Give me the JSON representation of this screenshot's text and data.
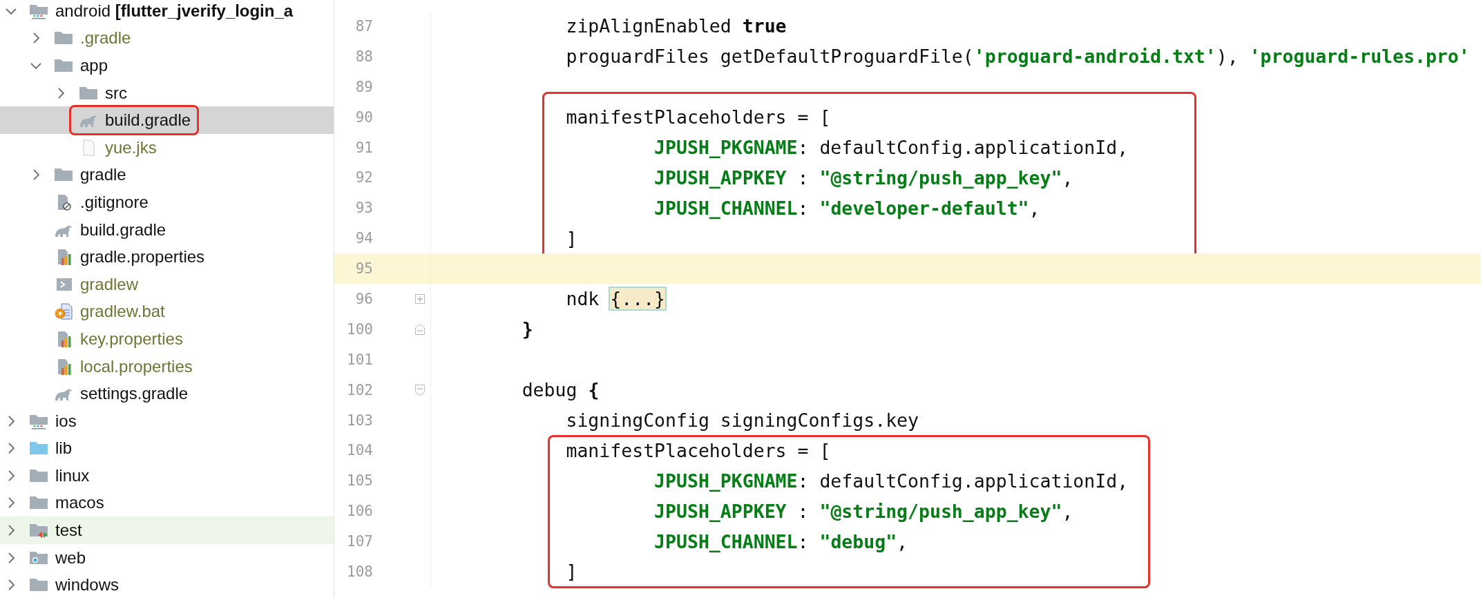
{
  "tree": [
    {
      "label": "android **[flutter_jverify_login_a**",
      "kind": "module",
      "expanded": true,
      "selected": false,
      "ignored": false,
      "highlighted": false,
      "annotated": false,
      "children": [
        {
          "label": ".gradle",
          "kind": "folder",
          "expanded": false,
          "selected": false,
          "ignored": true,
          "highlighted": false,
          "annotated": false
        },
        {
          "label": "app",
          "kind": "folder",
          "expanded": true,
          "selected": false,
          "ignored": false,
          "highlighted": false,
          "annotated": false,
          "children": [
            {
              "label": "src",
              "kind": "folder",
              "expanded": false,
              "selected": false,
              "ignored": false,
              "highlighted": false,
              "annotated": false
            },
            {
              "label": "build.gradle",
              "kind": "gradle",
              "selected": true,
              "ignored": false,
              "highlighted": false,
              "annotated": true
            },
            {
              "label": "yue.jks",
              "kind": "file",
              "selected": false,
              "ignored": true,
              "highlighted": false,
              "annotated": false
            }
          ]
        },
        {
          "label": "gradle",
          "kind": "folder",
          "expanded": false,
          "selected": false,
          "ignored": false,
          "highlighted": false,
          "annotated": false
        },
        {
          "label": ".gitignore",
          "kind": "gitignore",
          "selected": false,
          "ignored": false,
          "highlighted": false,
          "annotated": false
        },
        {
          "label": "build.gradle",
          "kind": "gradle",
          "selected": false,
          "ignored": false,
          "highlighted": false,
          "annotated": false
        },
        {
          "label": "gradle.properties",
          "kind": "properties",
          "selected": false,
          "ignored": false,
          "highlighted": false,
          "annotated": false
        },
        {
          "label": "gradlew",
          "kind": "shell",
          "selected": false,
          "ignored": true,
          "highlighted": false,
          "annotated": false
        },
        {
          "label": "gradlew.bat",
          "kind": "bat",
          "selected": false,
          "ignored": true,
          "highlighted": false,
          "annotated": false
        },
        {
          "label": "key.properties",
          "kind": "properties",
          "selected": false,
          "ignored": true,
          "highlighted": false,
          "annotated": false
        },
        {
          "label": "local.properties",
          "kind": "properties",
          "selected": false,
          "ignored": true,
          "highlighted": false,
          "annotated": false
        },
        {
          "label": "settings.gradle",
          "kind": "gradle",
          "selected": false,
          "ignored": false,
          "highlighted": false,
          "annotated": false
        }
      ]
    },
    {
      "label": "ios",
      "kind": "module",
      "expanded": false,
      "selected": false,
      "ignored": false,
      "highlighted": false,
      "annotated": false
    },
    {
      "label": "lib",
      "kind": "source",
      "expanded": false,
      "selected": false,
      "ignored": false,
      "highlighted": false,
      "annotated": false
    },
    {
      "label": "linux",
      "kind": "folder",
      "expanded": false,
      "selected": false,
      "ignored": false,
      "highlighted": false,
      "annotated": false
    },
    {
      "label": "macos",
      "kind": "folder",
      "expanded": false,
      "selected": false,
      "ignored": false,
      "highlighted": false,
      "annotated": false
    },
    {
      "label": "test",
      "kind": "test",
      "expanded": false,
      "selected": false,
      "ignored": false,
      "highlighted": true,
      "annotated": false
    },
    {
      "label": "web",
      "kind": "web",
      "expanded": false,
      "selected": false,
      "ignored": false,
      "highlighted": false,
      "annotated": false
    },
    {
      "label": "windows",
      "kind": "folder",
      "expanded": false,
      "selected": false,
      "ignored": false,
      "highlighted": false,
      "annotated": false
    }
  ],
  "editor": {
    "blocks": [
      {
        "boxed": false,
        "lines": [
          {
            "number": "87",
            "kind": "plain",
            "current": false,
            "tokens": [
              {
                "kind": "plain",
                "text": "            zipAlignEnabled "
              },
              {
                "kind": "keyword",
                "text": "true"
              }
            ]
          },
          {
            "number": "88",
            "kind": "plain",
            "current": false,
            "tokens": [
              {
                "kind": "plain",
                "text": "            proguardFiles getDefaultProguardFile("
              },
              {
                "kind": "string",
                "text": "'proguard-android.txt'"
              },
              {
                "kind": "plain",
                "text": "), "
              },
              {
                "kind": "string",
                "text": "'proguard-rules.pro'"
              }
            ]
          },
          {
            "number": "89",
            "kind": "plain",
            "current": false
          }
        ]
      },
      {
        "boxed": true,
        "lines": [
          {
            "number": "90",
            "kind": "plain",
            "current": false,
            "tokens": [
              {
                "kind": "plain",
                "text": "            manifestPlaceholders = ["
              }
            ]
          },
          {
            "number": "91",
            "kind": "plain",
            "current": false,
            "tokens": [
              {
                "kind": "key",
                "text": "                    JPUSH_PKGNAME"
              },
              {
                "kind": "plain",
                "text": ": defaultConfig.applicationId,"
              }
            ]
          },
          {
            "number": "92",
            "kind": "plain",
            "current": false,
            "tokens": [
              {
                "kind": "key",
                "text": "                    JPUSH_APPKEY"
              },
              {
                "kind": "plain",
                "text": " : "
              },
              {
                "kind": "string",
                "text": "\"@string/push_app_key\""
              },
              {
                "kind": "plain",
                "text": ","
              }
            ]
          },
          {
            "number": "93",
            "kind": "plain",
            "current": false,
            "tokens": [
              {
                "kind": "key",
                "text": "                    JPUSH_CHANNEL"
              },
              {
                "kind": "plain",
                "text": ": "
              },
              {
                "kind": "string",
                "text": "\"developer-default\""
              },
              {
                "kind": "plain",
                "text": ","
              }
            ]
          },
          {
            "number": "94",
            "kind": "plain",
            "current": false,
            "tokens": [
              {
                "kind": "plain",
                "text": "            ]"
              }
            ]
          }
        ]
      },
      {
        "boxed": false,
        "lines": [
          {
            "number": "95",
            "kind": "plain",
            "current": true
          },
          {
            "number": "96",
            "kind": "fold-collapsed",
            "current": false,
            "tokens": [
              {
                "kind": "plain",
                "text": "            ndk "
              },
              {
                "kind": "folded",
                "text": "{...}"
              }
            ]
          },
          {
            "number": "100",
            "kind": "fold-end",
            "current": false,
            "tokens": [
              {
                "kind": "brace",
                "text": "        }"
              }
            ]
          },
          {
            "number": "101",
            "kind": "plain",
            "current": false
          },
          {
            "number": "102",
            "kind": "fold-start",
            "current": false,
            "tokens": [
              {
                "kind": "plain",
                "text": "        debug "
              },
              {
                "kind": "brace",
                "text": "{"
              }
            ]
          },
          {
            "number": "103",
            "kind": "plain",
            "current": false,
            "tokens": [
              {
                "kind": "plain",
                "text": "            signingConfig signingConfigs.key"
              }
            ]
          }
        ]
      },
      {
        "boxed": true,
        "lines": [
          {
            "number": "104",
            "kind": "plain",
            "current": false,
            "tokens": [
              {
                "kind": "plain",
                "text": "            manifestPlaceholders = ["
              }
            ]
          },
          {
            "number": "105",
            "kind": "plain",
            "current": false,
            "tokens": [
              {
                "kind": "key",
                "text": "                    JPUSH_PKGNAME"
              },
              {
                "kind": "plain",
                "text": ": defaultConfig.applicationId,"
              }
            ]
          },
          {
            "number": "106",
            "kind": "plain",
            "current": false,
            "tokens": [
              {
                "kind": "key",
                "text": "                    JPUSH_APPKEY"
              },
              {
                "kind": "plain",
                "text": " : "
              },
              {
                "kind": "string",
                "text": "\"@string/push_app_key\""
              },
              {
                "kind": "plain",
                "text": ","
              }
            ]
          },
          {
            "number": "107",
            "kind": "plain",
            "current": false,
            "tokens": [
              {
                "kind": "key",
                "text": "                    JPUSH_CHANNEL"
              },
              {
                "kind": "plain",
                "text": ": "
              },
              {
                "kind": "string",
                "text": "\"debug\""
              },
              {
                "kind": "plain",
                "text": ","
              }
            ]
          },
          {
            "number": "108",
            "kind": "plain",
            "current": false,
            "tokens": [
              {
                "kind": "plain",
                "text": "            ]"
              }
            ]
          }
        ]
      }
    ]
  }
}
